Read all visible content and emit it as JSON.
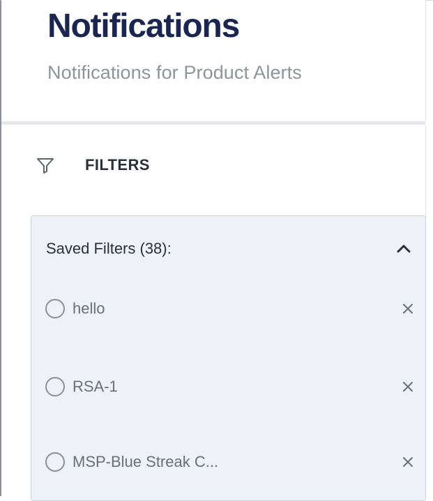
{
  "header": {
    "title": "Notifications",
    "subtitle": "Notifications for Product Alerts"
  },
  "filters": {
    "label": "FILTERS",
    "icon": "filter-funnel-icon"
  },
  "saved_filters": {
    "title": "Saved Filters (38):",
    "collapse_icon": "chevron-up-icon",
    "items": [
      {
        "label": "hello"
      },
      {
        "label": "RSA-1"
      },
      {
        "label": "MSP-Blue Streak C..."
      }
    ]
  },
  "colors": {
    "title": "#1a2550",
    "subtitle": "#8f949c",
    "panel_bg": "#eef1f7"
  }
}
